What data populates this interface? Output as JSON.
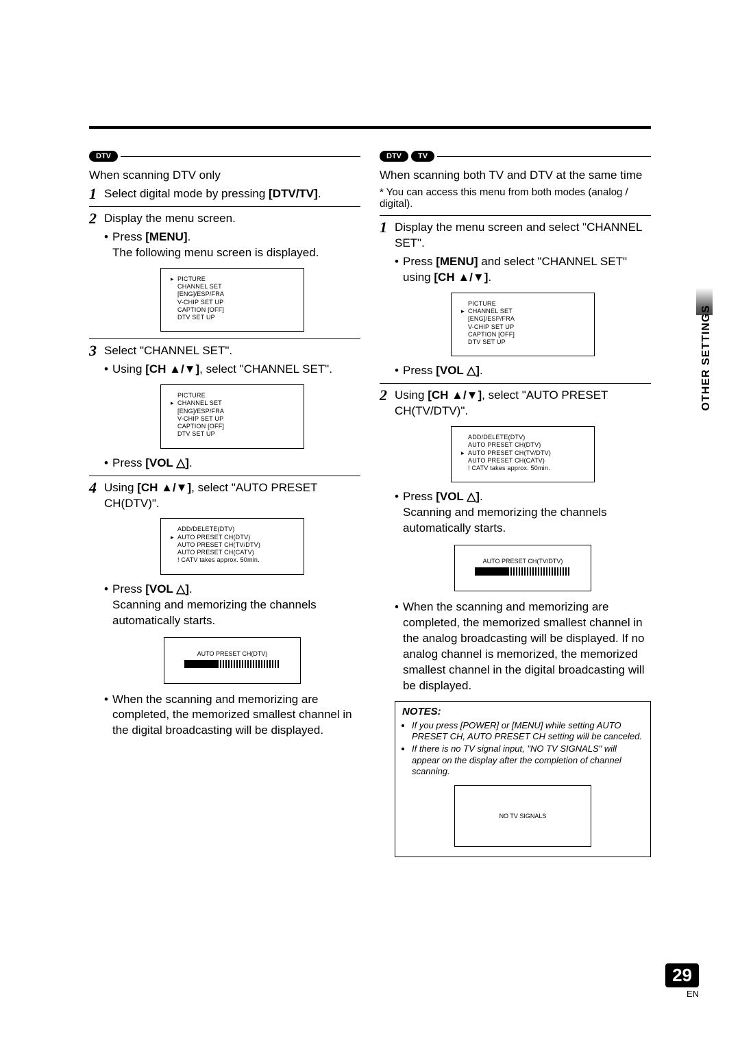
{
  "badges": {
    "dtv": "DTV",
    "tv": "TV"
  },
  "left": {
    "intro": "When scanning DTV only",
    "step1": "Select digital mode by pressing ",
    "step1_btn": "[DTV/TV]",
    "step1_end": ".",
    "step2": "Display the menu screen.",
    "step2_b1_a": "Press ",
    "step2_b1_btn": "[MENU]",
    "step2_b1_b": ".",
    "step2_line": "The following menu screen is displayed.",
    "osd_main": {
      "items": [
        "PICTURE",
        "CHANNEL SET",
        "[ENG]/ESP/FRA",
        "V-CHIP SET UP",
        "CAPTION [OFF]",
        "DTV SET UP"
      ],
      "marker_index": 0
    },
    "step3": "Select \"CHANNEL SET\".",
    "step3_b1_a": "Using ",
    "step3_b1_btn": "[CH ▲/▼]",
    "step3_b1_b": ", select \"CHANNEL SET\".",
    "osd_chset": {
      "items": [
        "PICTURE",
        "CHANNEL SET",
        "[ENG]/ESP/FRA",
        "V-CHIP SET UP",
        "CAPTION [OFF]",
        "DTV SET UP"
      ],
      "marker_index": 1
    },
    "press_vol_a": "Press ",
    "press_vol_btn": "[VOL ",
    "press_vol_b": "]",
    "press_vol_c": ".",
    "step4_a": "Using ",
    "step4_btn": "[CH ▲/▼]",
    "step4_b": ", select \"AUTO PRESET CH(DTV)\".",
    "osd_preset": {
      "items": [
        "ADD/DELETE(DTV)",
        "AUTO PRESET CH(DTV)",
        "AUTO PRESET CH(TV/DTV)",
        "AUTO PRESET CH(CATV)",
        "! CATV takes approx. 50min."
      ],
      "marker_index": 1
    },
    "scan_text": "Scanning and memorizing the channels automatically starts.",
    "progress_label": "AUTO PRESET CH(DTV)",
    "complete": "When the scanning and memorizing are completed, the memorized smallest channel in the digital broadcasting will be displayed."
  },
  "right": {
    "intro": "When scanning both TV and  DTV at the same time",
    "footnote": "* You can access this menu from both modes (analog / digital).",
    "step1": "Display the menu screen and select \"CHANNEL SET\".",
    "step1_b1_a": "Press ",
    "step1_b1_btn": "[MENU]",
    "step1_b1_b": " and select \"CHANNEL SET\" using ",
    "step1_b1_btn2": "[CH ▲/▼]",
    "step1_b1_c": ".",
    "osd_chset": {
      "items": [
        "PICTURE",
        "CHANNEL SET",
        "[ENG]/ESP/FRA",
        "V-CHIP SET UP",
        "CAPTION [OFF]",
        "DTV SET UP"
      ],
      "marker_index": 1
    },
    "press_vol_a": "Press ",
    "press_vol_btn": "[VOL ",
    "press_vol_b": "]",
    "press_vol_c": ".",
    "step2_a": "Using ",
    "step2_btn": "[CH ▲/▼]",
    "step2_b": ", select \"AUTO PRESET CH(TV/DTV)\".",
    "osd_preset": {
      "items": [
        "ADD/DELETE(DTV)",
        "AUTO PRESET CH(DTV)",
        "AUTO PRESET CH(TV/DTV)",
        "AUTO PRESET CH(CATV)",
        "! CATV takes approx. 50min."
      ],
      "marker_index": 2
    },
    "scan_text": "Scanning and memorizing the channels automatically starts.",
    "progress_label": "AUTO PRESET CH(TV/DTV)",
    "complete": "When the scanning and memorizing are completed, the memorized smallest channel in the analog broadcasting will be displayed. If no analog channel is memorized, the memorized smallest channel in the digital broadcasting will be displayed.",
    "notes_title": "NOTES:",
    "notes": [
      "If you press [POWER] or [MENU] while setting AUTO PRESET CH, AUTO PRESET CH setting will be canceled.",
      "If there is no TV signal input, \"NO TV SIGNALS\" will appear on the display after the completion of channel scanning."
    ],
    "no_signal": "NO TV SIGNALS"
  },
  "side_tab": "OTHER SETTINGS",
  "page_number": "29",
  "page_lang": "EN"
}
